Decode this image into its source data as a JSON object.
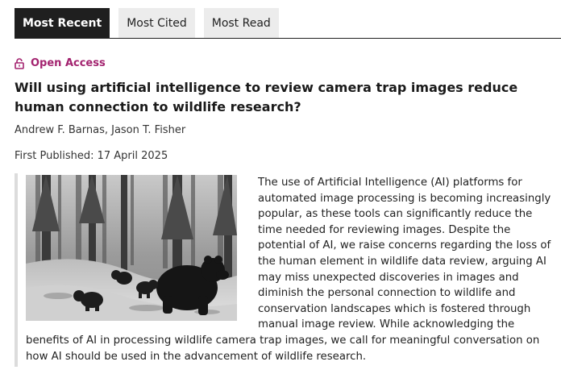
{
  "tabs": [
    {
      "label": "Most Recent",
      "active": true
    },
    {
      "label": "Most Cited",
      "active": false
    },
    {
      "label": "Most Read",
      "active": false
    }
  ],
  "article": {
    "access_label": "Open Access",
    "access_icon": "lock-open-icon",
    "title": "Will using artificial intelligence to review camera trap images reduce human connection to wildlife research?",
    "authors": "Andrew F. Barnas, Jason T. Fisher",
    "published_label": "First Published:",
    "published_date": "17 April 2025",
    "thumbnail_icon": "camera-trap-bears-image",
    "abstract": "The use of Artificial Intelligence (AI) platforms for automated image processing is becoming increasingly popular, as these tools can significantly reduce the time needed for reviewing images. Despite the potential of AI, we raise concerns regarding the loss of the human element in wildlife data review, arguing AI may miss unexpected discoveries in images and diminish the personal connection to wildlife and conservation landscapes which is fostered through manual image review. While acknowledging the benefits of AI in processing wildlife camera trap images, we call for meaningful conversation on how AI should be used in the advancement of wildlife research."
  },
  "colors": {
    "active_tab_bg": "#1f1f1f",
    "inactive_tab_bg": "#ececec",
    "open_access": "#a3236f"
  }
}
